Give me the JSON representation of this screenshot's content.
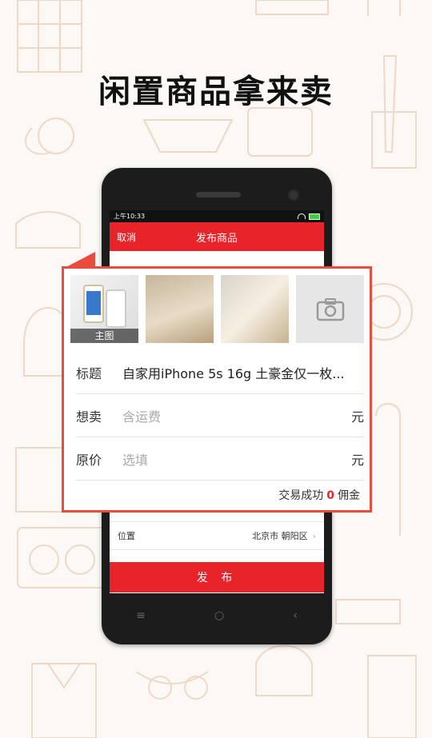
{
  "headline": "闲置商品拿来卖",
  "phone": {
    "status_time": "上午10:33",
    "titlebar": {
      "cancel": "取消",
      "title": "发布商品"
    },
    "location": {
      "label": "位置",
      "value": "北京市 朝阳区"
    },
    "publish_button": "发 布",
    "nav": {
      "menu": "≡",
      "home": "○",
      "back": "‹"
    }
  },
  "form": {
    "main_photo_label": "主图",
    "title_row": {
      "label": "标题",
      "value": "自家用iPhone 5s 16g 土豪金仅一枚..."
    },
    "want_row": {
      "label": "想卖",
      "placeholder": "含运费",
      "unit": "元"
    },
    "original_row": {
      "label": "原价",
      "placeholder": "选填",
      "unit": "元"
    },
    "commission": {
      "prefix": "交易成功",
      "value": "0",
      "suffix": "佣金"
    }
  },
  "colors": {
    "accent": "#e8242b",
    "callout_border": "#e74c3c"
  }
}
